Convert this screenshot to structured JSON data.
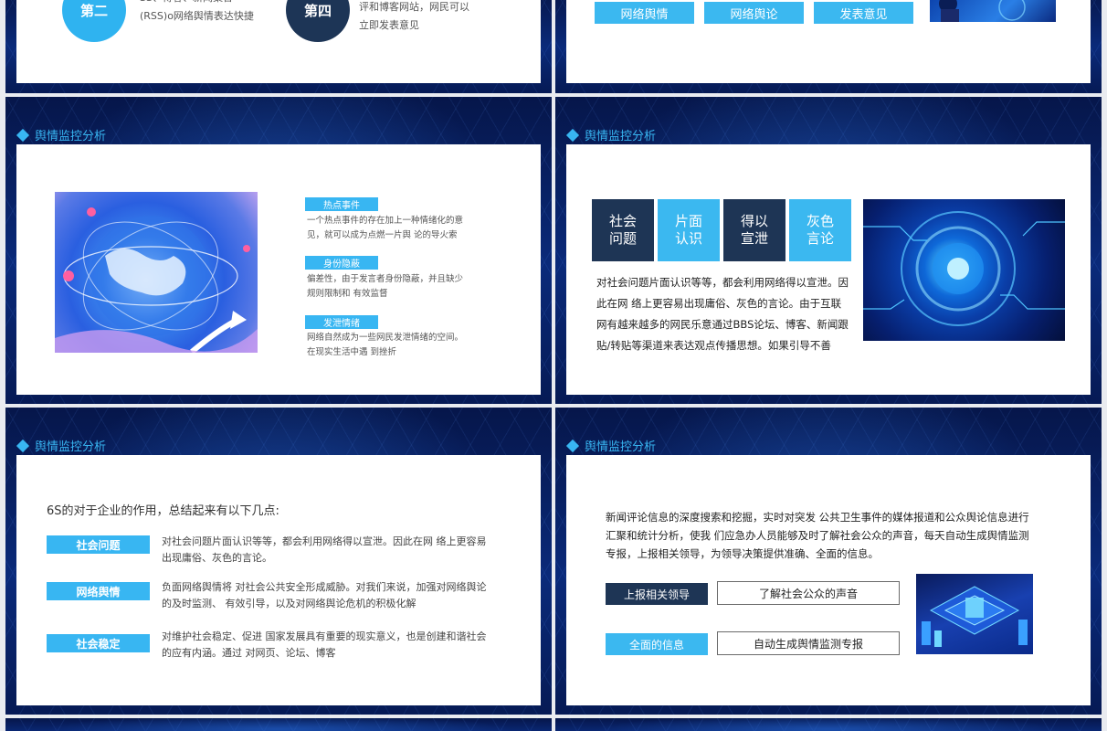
{
  "slide1": {
    "badge_left": "第二",
    "badge_right": "第四",
    "left_text_line1": "SS、博客、新闻聚合",
    "left_text_line2": "(RSS)o网络舆情表达快捷",
    "right_text_line1": "评和博客网站，网民可以",
    "right_text_line2": "立即发表意见"
  },
  "slide2": {
    "buttons": [
      "网络舆情",
      "网络舆论",
      "发表意见"
    ]
  },
  "slide3": {
    "title": "舆情监控分析",
    "items": [
      {
        "label": "热点事件",
        "line1": "一个热点事件的存在加上一种情绪化的意",
        "line2": "见，就可以成为点燃一片舆 论的导火索"
      },
      {
        "label": "身份隐蔽",
        "line1": "偏差性，由于发言者身份隐蔽，并且缺少",
        "line2": "规则限制和 有效监督"
      },
      {
        "label": "发泄情绪",
        "line1": "网络自然成为一些网民发泄情绪的空间。",
        "line2": "在现实生活中遇 到挫折"
      }
    ]
  },
  "slide4": {
    "title": "舆情监控分析",
    "squares": [
      {
        "l1": "社会",
        "l2": "问题"
      },
      {
        "l1": "片面",
        "l2": "认识"
      },
      {
        "l1": "得以",
        "l2": "宣泄"
      },
      {
        "l1": "灰色",
        "l2": "言论"
      }
    ],
    "para": [
      "对社会问题片面认识等等，都会利用网络得以宣泄。因",
      "此在网 络上更容易出现庸俗、灰色的言论。由于互联",
      "网有越来越多的网民乐意通过BBS论坛、博客、新闻跟",
      "贴/转贴等渠道来表达观点传播思想。如果引导不善"
    ]
  },
  "slide5": {
    "title": "舆情监控分析",
    "intro": "6S的对于企业的作用，总结起来有以下几点:",
    "rows": [
      {
        "label": "社会问题",
        "line1": "对社会问题片面认识等等，都会利用网络得以宣泄。因此在网 络上更容易",
        "line2": "出现庸俗、灰色的言论。"
      },
      {
        "label": "网络舆情",
        "line1": "负面网络舆情将 对社会公共安全形成威胁。对我们来说，加强对网络舆论",
        "line2": "的及时监测、 有效引导，以及对网络舆论危机的积极化解"
      },
      {
        "label": "社会稳定",
        "line1": "对维护社会稳定、促进 国家发展具有重要的现实意义，也是创建和谐社会",
        "line2": "的应有内涵。通过 对网页、论坛、博客"
      }
    ]
  },
  "slide6": {
    "title": "舆情监控分析",
    "para": [
      "新闻评论信息的深度搜索和挖掘，实时对突发 公共卫生事件的媒体报道和公众舆论信息进行",
      "汇聚和统计分析，使我 们应急办人员能够及时了解社会公众的声音，每天自动生成舆情监测",
      "专报，上报相关领导，为领导决策提供准确、全面的信息。"
    ],
    "box1": "上报相关领导",
    "box2": "了解社会公众的声音",
    "box3": "全面的信息",
    "box4": "自动生成舆情监测专报"
  },
  "colors": {
    "accent": "#38b6f2",
    "dark": "#1e3555",
    "bg": "#06164a"
  }
}
